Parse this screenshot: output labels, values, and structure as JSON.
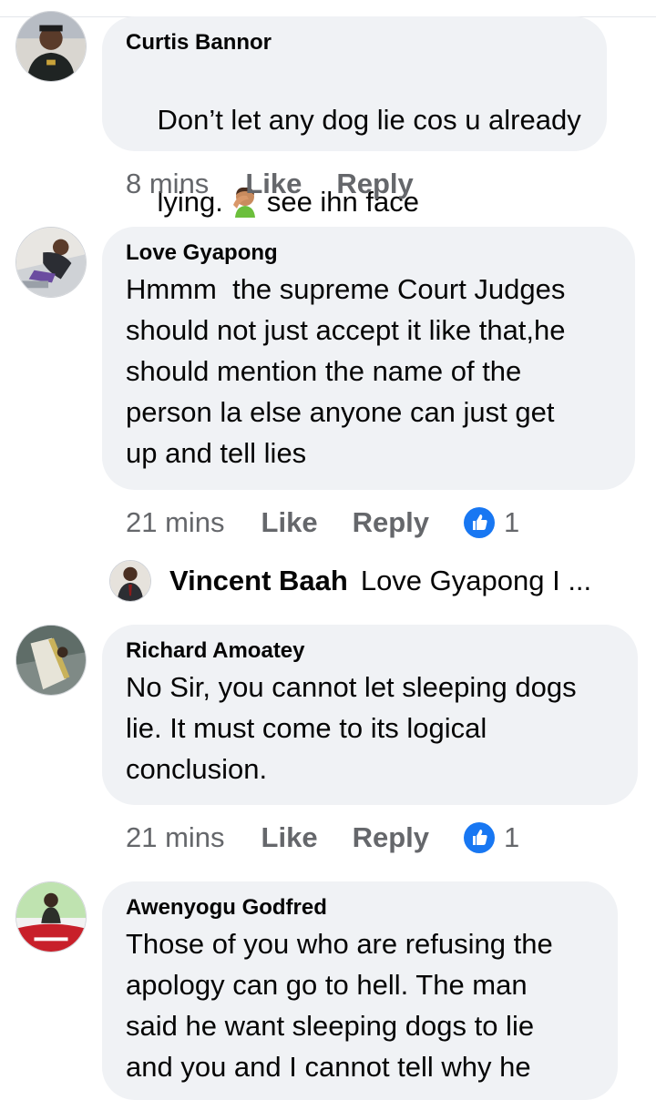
{
  "comments": [
    {
      "author": "Curtis Bannor",
      "text_line1_a": "Don’t let any dog lie cos u already",
      "text_line2_a": "lying.",
      "emoji": "man-facepalming-emoji",
      "text_line2_b": "see ihn face",
      "time": "8 mins",
      "like": "Like",
      "reply": "Reply"
    },
    {
      "author": "Love Gyapong",
      "text": "Hmmm  the supreme Court Judges\nshould not just accept it like that,he\nshould mention the name of the\nperson la else anyone can just get\nup and tell lies",
      "time": "21 mins",
      "like": "Like",
      "reply": "Reply",
      "reaction_count": "1"
    },
    {
      "author": "Richard Amoatey",
      "text": "No Sir, you cannot let sleeping dogs\nlie. It must come to its logical\nconclusion.",
      "time": "21 mins",
      "like": "Like",
      "reply": "Reply",
      "reaction_count": "1"
    },
    {
      "author": "Awenyogu Godfred",
      "text": "Those of you who are refusing the\napology can go to hell. The man\nsaid he want sleeping dogs to lie\nand you and I cannot tell why he"
    }
  ],
  "reply_preview": {
    "author": "Vincent Baah",
    "text": "Love Gyapong I ..."
  },
  "colors": {
    "bubble": "#f0f2f5",
    "meta_text": "#65676b",
    "like_blue": "#1877f2"
  }
}
